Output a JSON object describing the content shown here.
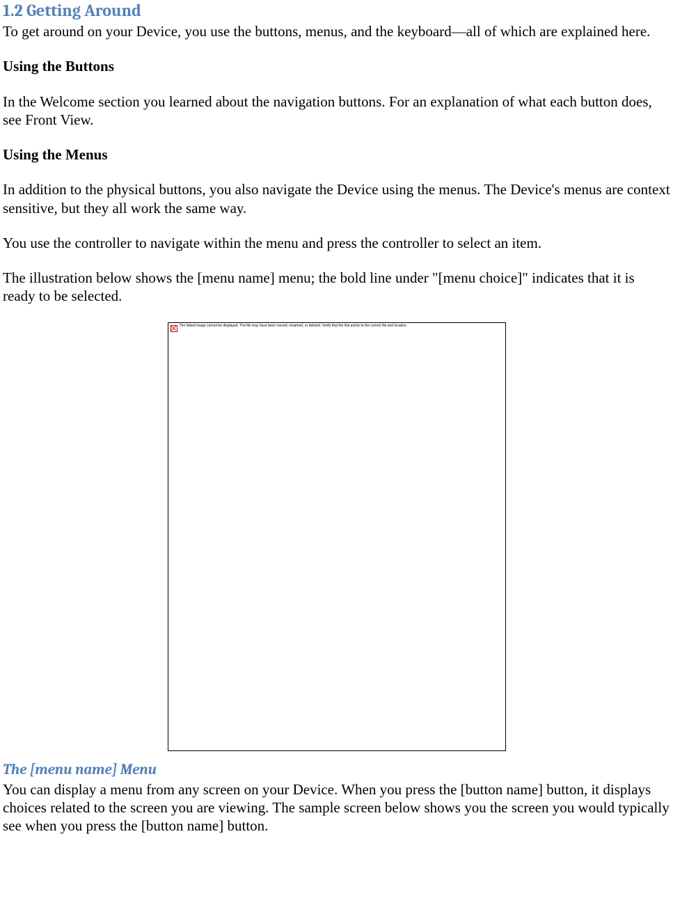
{
  "heading_1_2": "1.2 Getting Around",
  "intro_para": "To get around on your Device, you use the buttons, menus, and the keyboard—all of which are explained here.",
  "buttons_heading": "Using the Buttons",
  "buttons_para": "In the Welcome section you learned about the navigation buttons. For an explanation of what each button does, see Front View.",
  "menus_heading": "Using the Menus",
  "menus_para1": "In addition to the physical buttons, you also navigate the Device using the menus. The Device's menus are context sensitive, but they all work the same way.",
  "menus_para2": "You use the controller to navigate within the menu and press the controller to select an item.",
  "menus_para3": "The illustration below shows the [menu name] menu; the bold line under \"[menu choice]\" indicates that it is ready to be selected.",
  "placeholder_alt": "The linked image cannot be displayed. The file may have been moved, renamed, or deleted. Verify that the link points to the correct file and location.",
  "menu_heading": "The [menu name] Menu",
  "menu_para": "You can display a menu from any screen on your Device. When you press the [button name] button, it displays choices related to the screen you are viewing. The sample screen below shows you the screen you would typically see when you press the [button name] button."
}
